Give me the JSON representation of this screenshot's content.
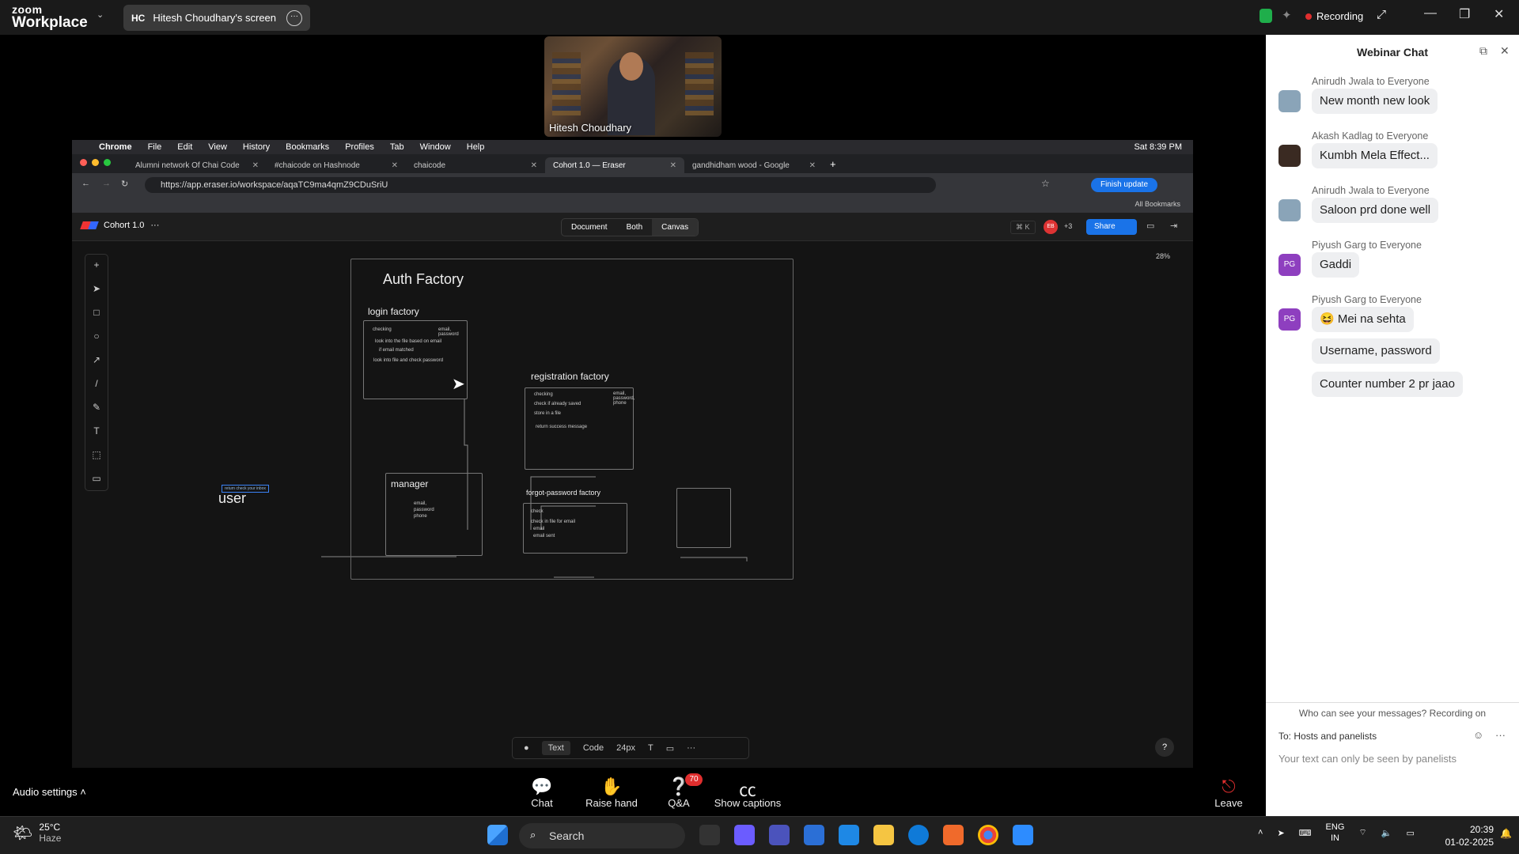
{
  "zoom": {
    "logo_top": "zoom",
    "logo_bottom": "Workplace",
    "share_initials": "HC",
    "share_title": "Hitesh Choudhary's screen",
    "recording_label": "Recording",
    "speaker_name": "Hitesh Choudhary",
    "audio_settings": "Audio settings",
    "buttons": {
      "chat": "Chat",
      "raise_hand": "Raise hand",
      "qa": "Q&A",
      "captions": "Show captions",
      "leave": "Leave"
    },
    "qa_count": "70"
  },
  "mac": {
    "menu": [
      "Chrome",
      "File",
      "Edit",
      "View",
      "History",
      "Bookmarks",
      "Profiles",
      "Tab",
      "Window",
      "Help"
    ],
    "clock": "Sat 8:39 PM"
  },
  "browser": {
    "tabs": [
      "Alumni network Of Chai Code",
      "#chaicode on Hashnode",
      "chaicode",
      "Cohort 1.0 — Eraser",
      "gandhidham wood - Google"
    ],
    "url": "https://app.eraser.io/workspace/aqaTC9ma4qmZ9CDuSriU",
    "finish_update": "Finish update",
    "all_bookmarks": "All Bookmarks"
  },
  "eraser": {
    "doc_title": "Cohort 1.0",
    "views": [
      "Document",
      "Both",
      "Canvas"
    ],
    "shortcut": "⌘ K",
    "avatar_initials": "EB",
    "others_count": "+3",
    "share": "Share",
    "zoom_level": "28%",
    "bottom_tools": {
      "text": "Text",
      "code": "Code",
      "size": "24px",
      "font": "T"
    },
    "help": "?"
  },
  "diagram": {
    "title": "Auth Factory",
    "login": {
      "title": "login factory",
      "lines": [
        "checking",
        "email, password",
        "look into the file based on email",
        "if email matched",
        "look into file and check password"
      ]
    },
    "registration": {
      "title": "registration factory",
      "lines": [
        "checking",
        "email, password, phone",
        "check if already saved",
        "store in a file",
        "return success message"
      ]
    },
    "manager": {
      "title": "manager",
      "lines": [
        "email,",
        "password",
        "phone"
      ]
    },
    "forgot": {
      "title": "forgot-password factory",
      "lines": [
        "check",
        "check in file for email",
        "email",
        "email sent"
      ]
    },
    "user": {
      "title": "user",
      "note": "return check your inbox"
    }
  },
  "chat": {
    "title": "Webinar Chat",
    "messages": [
      {
        "from": "Anirudh Jwala to Everyone",
        "text": "New month new look",
        "avatar": ""
      },
      {
        "from": "Akash Kadlag to Everyone",
        "text": "Kumbh Mela Effect...",
        "avatar": ""
      },
      {
        "from": "Anirudh Jwala to Everyone",
        "text": "Saloon prd done well",
        "avatar": ""
      },
      {
        "from": "Piyush Garg to Everyone",
        "text": "Gaddi",
        "avatar": "PG"
      },
      {
        "from": "Piyush Garg to Everyone",
        "text": "😆 Mei na sehta",
        "avatar": "PG"
      }
    ],
    "followups": [
      "Username, password",
      "Counter number 2 pr jaao"
    ],
    "who_can_see": "Who can see your messages? Recording on",
    "to_label": "To:",
    "to_value": "Hosts and panelists",
    "input_placeholder": "Your text can only be seen by panelists"
  },
  "taskbar": {
    "temp": "25°C",
    "weather": "Haze",
    "search": "Search",
    "lang_top": "ENG",
    "lang_bottom": "IN",
    "time": "20:39",
    "date": "01-02-2025"
  },
  "colors": {
    "accent": "#1a73e8",
    "recording": "#e02e2e",
    "chat_bg": "#ffffff"
  }
}
